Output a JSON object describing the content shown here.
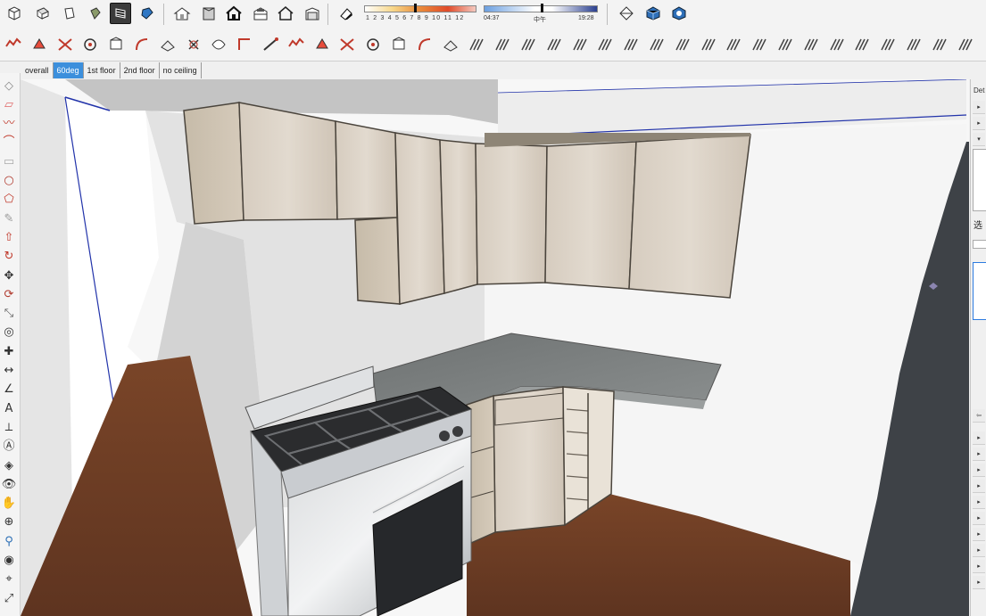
{
  "toolbar_top": {
    "groups": [
      {
        "name": "views",
        "icons": [
          "iso-view-icon",
          "top-view-icon",
          "front-view-icon",
          "right-view-icon",
          "back-view-icon",
          "left-view-icon"
        ]
      },
      {
        "name": "styles",
        "icons": [
          "xray-style-icon",
          "back-edges-style-icon",
          "wireframe-style-icon",
          "hidden-line-style-icon",
          "shaded-style-icon",
          "shaded-textures-style-icon",
          "monochrome-style-icon"
        ]
      }
    ],
    "shadows": {
      "month_ticks": "1 2 3 4 5 6 7 8 9 10 11 12",
      "sunrise": "04:37",
      "midday": "中午",
      "sunset": "19:28"
    },
    "extra_icons": [
      "section-plane-icon",
      "section-display-icon",
      "section-cut-icon"
    ]
  },
  "toolbar_plugins": {
    "icon_count": 38
  },
  "scenes": {
    "tabs": [
      "overall",
      "60deg",
      "1st floor",
      "2nd floor",
      "no ceiling"
    ],
    "selected": "60deg"
  },
  "left_toolbar": {
    "tools": [
      "select-tool-icon",
      "eraser-tool-icon",
      "line-tool-icon",
      "arc-tool-icon",
      "rectangle-tool-icon",
      "circle-tool-icon",
      "polygon-tool-icon",
      "freehand-tool-icon",
      "pushpull-tool-icon",
      "followme-tool-icon",
      "move-tool-icon",
      "rotate-tool-icon",
      "scale-tool-icon",
      "offset-tool-icon",
      "tape-tool-icon",
      "dimension-tool-icon",
      "protractor-tool-icon",
      "text-tool-icon",
      "axes-tool-icon",
      "3dtext-tool-icon",
      "paint-tool-icon",
      "orbit-tool-icon",
      "pan-tool-icon",
      "zoom-tool-icon",
      "walk-tool-icon",
      "lookaround-tool-icon",
      "position-camera-icon",
      "zoom-extents-icon"
    ]
  },
  "right_panel": {
    "title": "Det",
    "text": "选"
  },
  "colors": {
    "wood": "#d9d0c4",
    "counter": "#7f8282",
    "floor": "#6e3f26",
    "wall_dark": "#3e4247",
    "scene_selected": "#3c8fdc"
  }
}
